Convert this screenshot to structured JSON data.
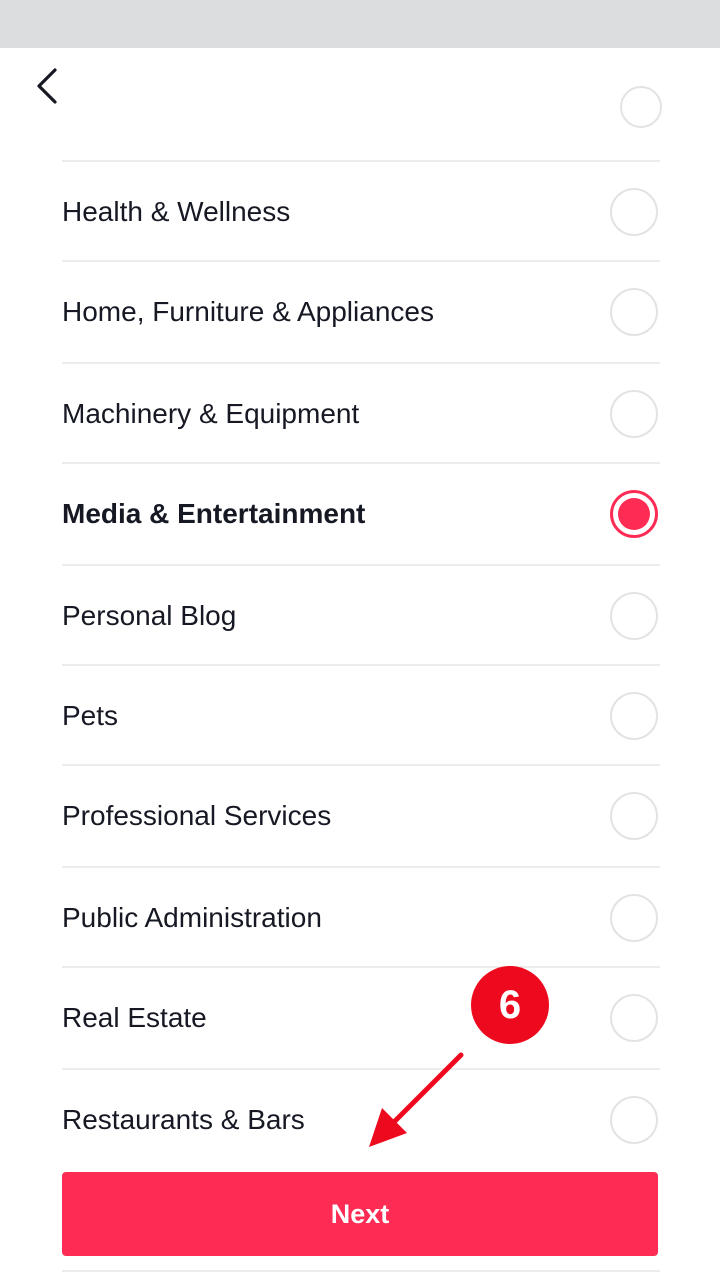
{
  "header": {
    "back_icon": "chevron-left-icon"
  },
  "categories": [
    {
      "label": "Health & Wellness",
      "selected": false
    },
    {
      "label": "Home, Furniture & Appliances",
      "selected": false
    },
    {
      "label": "Machinery & Equipment",
      "selected": false
    },
    {
      "label": "Media & Entertainment",
      "selected": true
    },
    {
      "label": "Personal Blog",
      "selected": false
    },
    {
      "label": "Pets",
      "selected": false
    },
    {
      "label": "Professional Services",
      "selected": false
    },
    {
      "label": "Public Administration",
      "selected": false
    },
    {
      "label": "Real Estate",
      "selected": false
    },
    {
      "label": "Restaurants & Bars",
      "selected": false
    }
  ],
  "footer": {
    "next_label": "Next"
  },
  "annotation": {
    "step_number": "6",
    "arrow_icon": "arrow-pointer-icon"
  },
  "colors": {
    "accent": "#fe2c55",
    "annotation": "#ee0a1e",
    "text": "#161823",
    "divider": "#ececed",
    "status_bar": "#dcdddf"
  }
}
